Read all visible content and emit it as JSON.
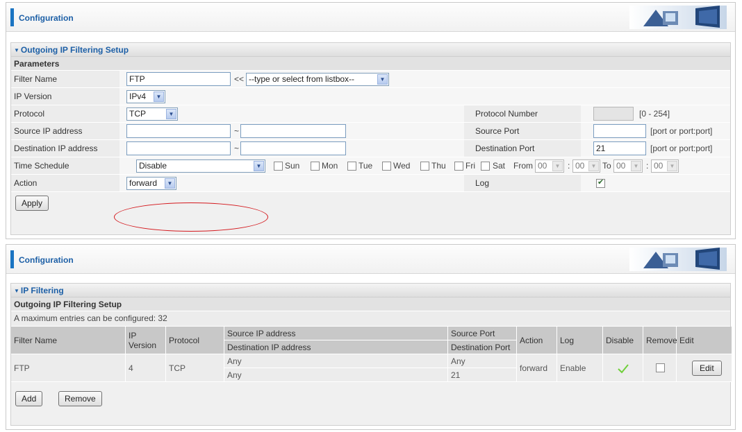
{
  "panel1": {
    "header_title": "Configuration",
    "section_title": "Outgoing IP Filtering Setup",
    "parameters_label": "Parameters",
    "filter_name": {
      "label": "Filter Name",
      "value": "FTP",
      "arrows": "<<",
      "listbox": "--type or select from listbox--"
    },
    "ip_version": {
      "label": "IP Version",
      "value": "IPv4"
    },
    "protocol": {
      "label": "Protocol",
      "value": "TCP"
    },
    "protocol_number": {
      "label": "Protocol Number",
      "value": "",
      "hint": "[0 - 254]"
    },
    "source_ip": {
      "label": "Source IP address",
      "from": "",
      "tilde": "~",
      "to": ""
    },
    "source_port": {
      "label": "Source Port",
      "value": "",
      "hint": "[port or port:port]"
    },
    "destination_ip": {
      "label": "Destination IP address",
      "from": "",
      "tilde": "~",
      "to": ""
    },
    "destination_port": {
      "label": "Destination Port",
      "value": "21",
      "hint": "[port or port:port]"
    },
    "time_schedule": {
      "label": "Time Schedule",
      "value": "Disable",
      "days": [
        "Sun",
        "Mon",
        "Tue",
        "Wed",
        "Thu",
        "Fri",
        "Sat"
      ],
      "from_label": "From",
      "from_hour": "00",
      "from_min": "00",
      "colon": ":",
      "to_label": "To",
      "to_hour": "00",
      "to_min": "00"
    },
    "action": {
      "label": "Action",
      "value": "forward"
    },
    "log": {
      "label": "Log",
      "checked": true
    },
    "apply_label": "Apply"
  },
  "panel2": {
    "header_title": "Configuration",
    "section_title": "IP Filtering",
    "subhead": "Outgoing IP Filtering Setup",
    "max_entries": "A maximum entries can be configured: 32",
    "columns": {
      "filter_name": "Filter Name",
      "ip_version": "IP Version",
      "protocol": "Protocol",
      "source_ip": "Source IP address",
      "destination_ip": "Destination IP address",
      "source_port": "Source Port",
      "destination_port": "Destination Port",
      "action": "Action",
      "log": "Log",
      "disable": "Disable",
      "remove": "Remove",
      "edit": "Edit"
    },
    "rows": [
      {
        "filter_name": "FTP",
        "ip_version": "4",
        "protocol": "TCP",
        "source_ip": "Any",
        "destination_ip": "Any",
        "source_port": "Any",
        "destination_port": "21",
        "action": "forward",
        "log": "Enable",
        "edit_label": "Edit"
      }
    ],
    "add_label": "Add",
    "remove_label": "Remove"
  },
  "colors": {
    "accent": "#1b74c2",
    "title_text": "#1c5fa6",
    "highlight": "#d4171c",
    "check": "#6fcf3a"
  }
}
